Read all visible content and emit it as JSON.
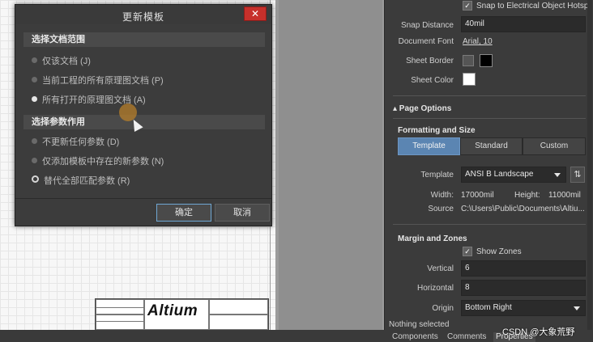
{
  "dialog": {
    "title": "更新模板",
    "close_glyph": "✕",
    "scope_group": {
      "label": "选择文档范围",
      "options": [
        "仅该文档 (J)",
        "当前工程的所有原理图文档 (P)",
        "所有打开的原理图文档 (A)"
      ],
      "selected": 2
    },
    "param_group": {
      "label": "选择参数作用",
      "options": [
        "不更新任何参数 (D)",
        "仅添加模板中存在的新参数 (N)",
        "替代全部匹配参数 (R)"
      ],
      "selected": 2
    },
    "ok_label": "确定",
    "cancel_label": "取消"
  },
  "properties": {
    "snap_checkbox_label": "Snap to Electrical Object Hotsp",
    "snap_distance_label": "Snap Distance",
    "snap_distance_value": "40mil",
    "document_font_label": "Document Font",
    "document_font_value": "Arial, 10",
    "sheet_border_label": "Sheet Border",
    "sheet_border_color": "#000000",
    "sheet_color_label": "Sheet Color",
    "sheet_color_value": "#ffffff",
    "page_options_label": "▴ Page Options",
    "formatting_label": "Formatting and Size",
    "format_tabs": [
      "Template",
      "Standard",
      "Custom"
    ],
    "active_format_tab": 0,
    "template_label": "Template",
    "template_value": "ANSI B Landscape",
    "width_label": "Width:",
    "width_value": "17000mil",
    "height_label": "Height:",
    "height_value": "11000mil",
    "source_label": "Source",
    "source_value": "C:\\Users\\Public\\Documents\\Altiu...",
    "margin_label": "Margin and Zones",
    "show_zones_label": "Show Zones",
    "vertical_label": "Vertical",
    "vertical_value": "6",
    "horizontal_label": "Horizontal",
    "horizontal_value": "8",
    "origin_label": "Origin",
    "origin_value": "Bottom Right"
  },
  "titleblock": {
    "logo": "Altium"
  },
  "status": {
    "message": "Nothing selected",
    "tabs": [
      "Components",
      "Comments",
      "Properties"
    ],
    "active_tab": 2,
    "watermark": "CSDN @大象荒野"
  }
}
